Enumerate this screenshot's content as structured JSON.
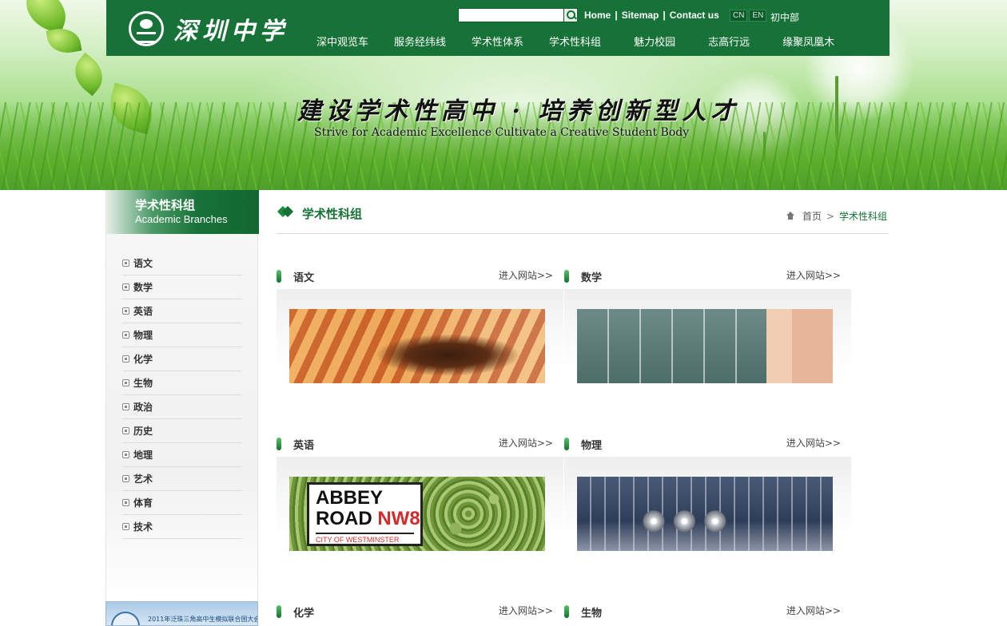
{
  "header": {
    "logo_text": "深圳中学",
    "search": {
      "value": "",
      "placeholder": ""
    },
    "top_links": [
      "Home",
      "Sitemap",
      "Contact us"
    ],
    "link_separator": "|",
    "languages": [
      "CN",
      "EN"
    ],
    "junior_link": "初中部",
    "nav": [
      "深中观览车",
      "服务经纬线",
      "学术性体系",
      "学术性科组",
      "魅力校园",
      "志高行远",
      "缘聚凤凰木"
    ],
    "brand_color": "#177237"
  },
  "banner": {
    "slogan_cn": "建设学术性高中 · 培养创新型人才",
    "slogan_en": "Strive for Academic Excellence Cultivate a Creative Student Body"
  },
  "sidebar": {
    "title_cn": "学术性科组",
    "title_en": "Academic Branches",
    "items": [
      "语文",
      "数学",
      "英语",
      "物理",
      "化学",
      "生物",
      "政治",
      "历史",
      "地理",
      "艺术",
      "体育",
      "技术"
    ],
    "ad_text": "2011年泛珠三角高中生模拟联合国大会"
  },
  "main": {
    "title": "学术性科组",
    "breadcrumb": {
      "home": "首页",
      "separator": ">",
      "current": "学术性科组"
    },
    "more_label": "进入网站>>",
    "cards": [
      {
        "title": "语文",
        "image": "chinese-calligraphy"
      },
      {
        "title": "数学",
        "image": "chalkboard-hand"
      },
      {
        "title": "英语",
        "image": "abbey-road-sign"
      },
      {
        "title": "物理",
        "image": "newtons-cradle"
      },
      {
        "title": "化学",
        "image": ""
      },
      {
        "title": "生物",
        "image": ""
      }
    ],
    "sign": {
      "line1": "ABBEY",
      "line2a": "ROAD",
      "line2b": "NW8",
      "line3": "CITY OF WESTMINSTER"
    }
  }
}
